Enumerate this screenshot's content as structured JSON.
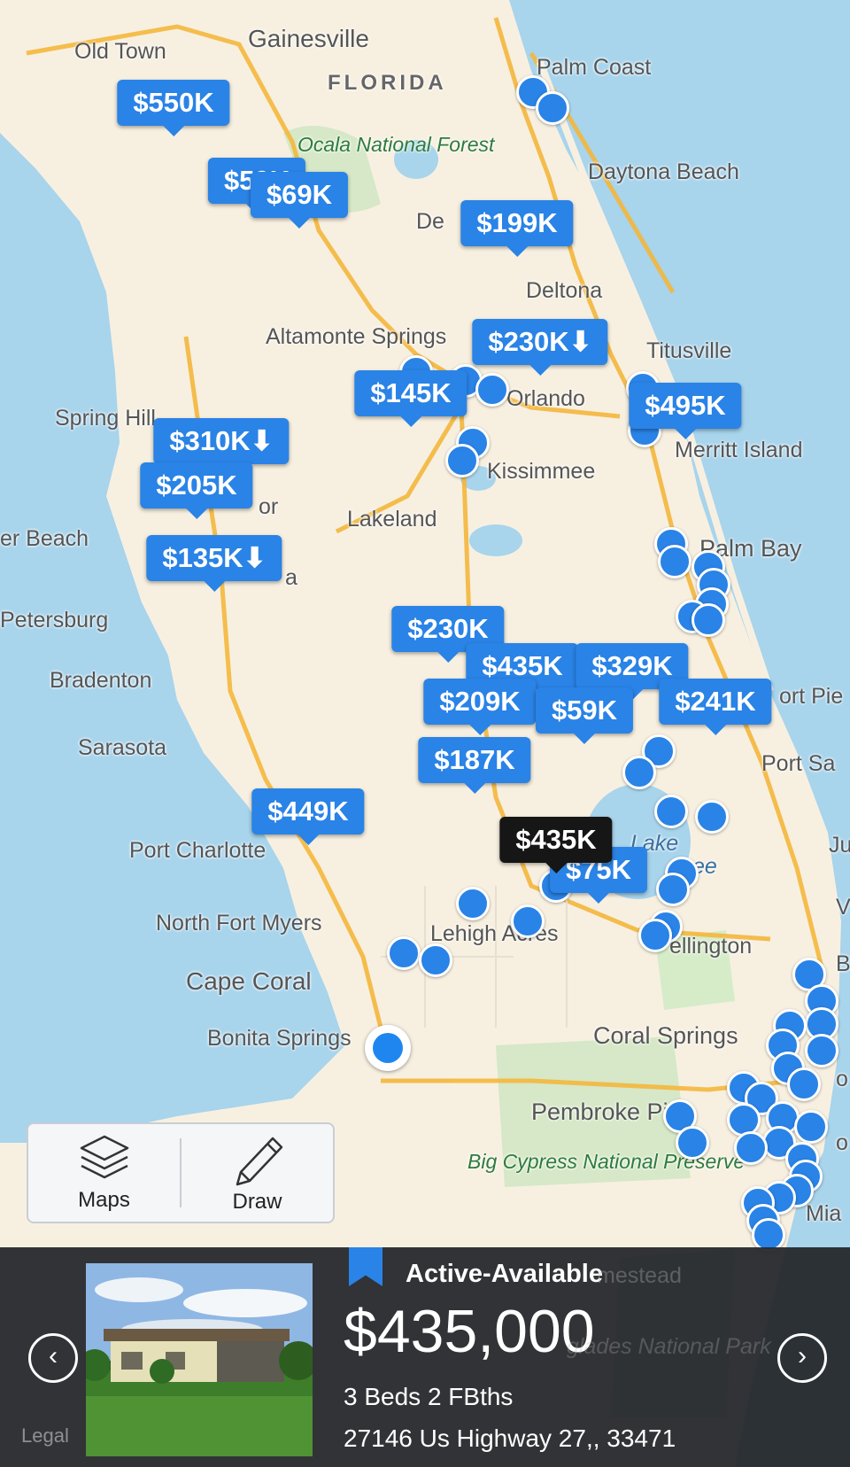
{
  "colors": {
    "pin": "#2a83e6",
    "selected_pin": "#161616",
    "water": "#a8d4ec",
    "land": "#f7f0e1"
  },
  "map": {
    "place_labels": [
      "Old Town",
      "Gainesville",
      "FLORIDA",
      "Palm Coast",
      "Ocala National Forest",
      "Daytona Beach",
      "De",
      "Deltona",
      "Altamonte Springs",
      "Titusville",
      "Spring Hill",
      "Orlando",
      "Merritt Island",
      "Kissimmee",
      "or",
      "Lakeland",
      "er Beach",
      "Palm Bay",
      "a",
      "Petersburg",
      "Bradenton",
      "ort Pie",
      "Sarasota",
      "Port Sa",
      "Port Charlotte",
      "Lake",
      "ee",
      "Ju",
      "North Fort Myers",
      "Lehigh Acres",
      "ellington",
      "V",
      "Cape Coral",
      "B",
      "Bonita Springs",
      "Coral Springs",
      "o",
      "Pembroke Pine",
      "o",
      "Big Cypress National Preserve",
      "Mia",
      "mestead",
      "glades National Park"
    ],
    "price_pins": [
      "$550K",
      "$59K",
      "$69K",
      "$199K",
      "$230K⬇",
      "$145K",
      "$495K",
      "$310K⬇",
      "$205K",
      "$135K⬇",
      "$230K",
      "$435K",
      "$329K",
      "$209K",
      "$59K",
      "$241K",
      "$187K",
      "$449K",
      "$75K",
      "$435K"
    ]
  },
  "toolbar": {
    "maps_label": "Maps",
    "draw_label": "Draw"
  },
  "listing": {
    "status": "Active-Available",
    "price": "$435,000",
    "beds_baths": "3 Beds 2 FBths",
    "address": "27146 Us Highway 27,, 33471",
    "prev": "‹",
    "next": "›"
  },
  "legal": "Legal"
}
